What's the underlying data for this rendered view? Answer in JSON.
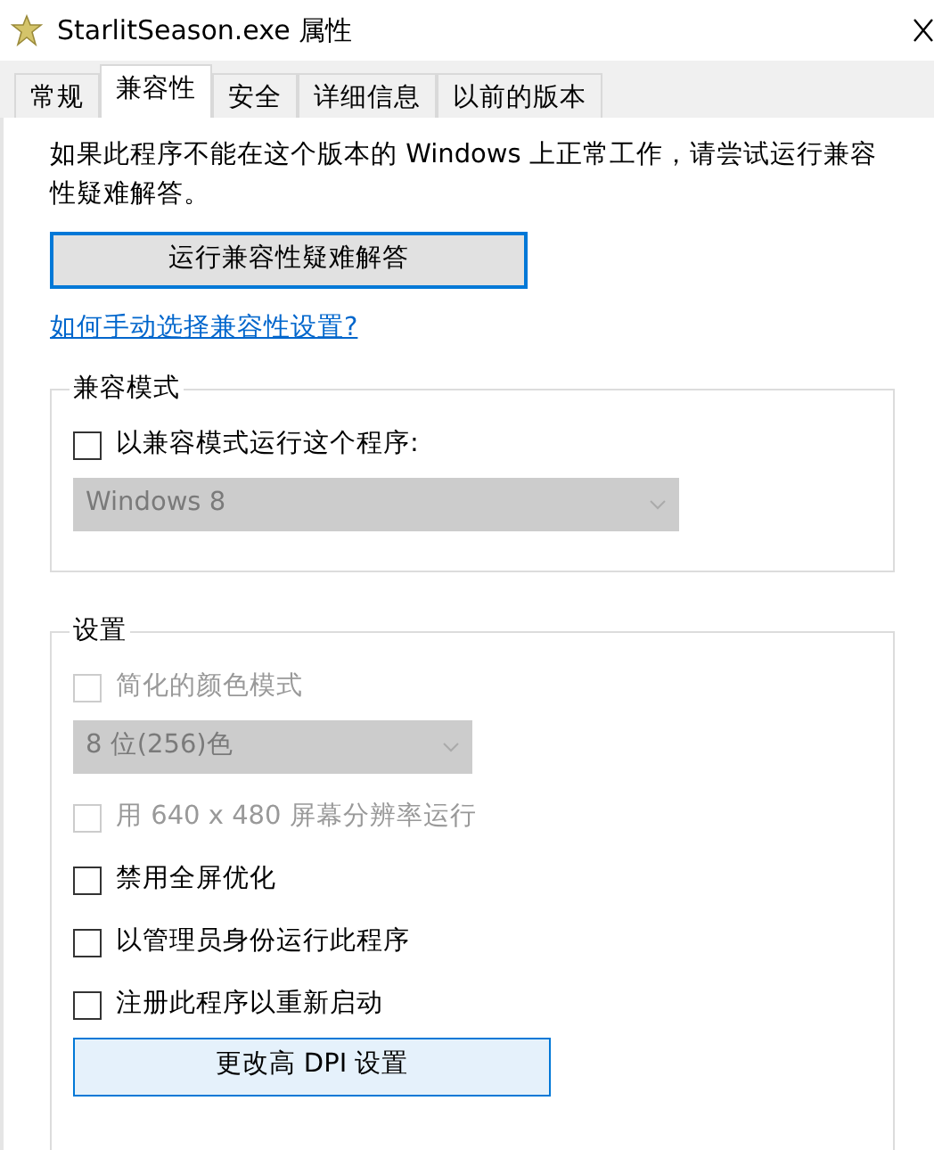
{
  "window": {
    "title": "StarlitSeason.exe 属性"
  },
  "tabs": [
    {
      "label": "常规",
      "selected": false
    },
    {
      "label": "兼容性",
      "selected": true
    },
    {
      "label": "安全",
      "selected": false
    },
    {
      "label": "详细信息",
      "selected": false
    },
    {
      "label": "以前的版本",
      "selected": false
    }
  ],
  "intro": "如果此程序不能在这个版本的 Windows 上正常工作，请尝试运行兼容性疑难解答。",
  "troubleshoot_button": {
    "label": "运行兼容性疑难解答",
    "focused": true
  },
  "help_link": "如何手动选择兼容性设置?",
  "compat_mode": {
    "title": "兼容模式",
    "items": [
      {
        "kind": "checkbox",
        "label": "以兼容模式运行这个程序:",
        "checked": false,
        "disabled": false
      },
      {
        "kind": "dropdown",
        "value": "Windows 8",
        "disabled": true
      }
    ]
  },
  "settings": {
    "title": "设置",
    "items": [
      {
        "kind": "checkbox",
        "label": "简化的颜色模式",
        "checked": false,
        "disabled": true
      },
      {
        "kind": "dropdown",
        "value": "8 位(256)色",
        "disabled": true
      },
      {
        "kind": "checkbox",
        "label": "用 640 x 480 屏幕分辨率运行",
        "checked": false,
        "disabled": true
      },
      {
        "kind": "checkbox",
        "label": "禁用全屏优化",
        "checked": false,
        "disabled": false
      },
      {
        "kind": "checkbox",
        "label": "以管理员身份运行此程序",
        "checked": false,
        "disabled": false
      },
      {
        "kind": "checkbox",
        "label": "注册此程序以重新启动",
        "checked": false,
        "disabled": false
      }
    ],
    "button": {
      "label": "更改高 DPI 设置"
    }
  }
}
